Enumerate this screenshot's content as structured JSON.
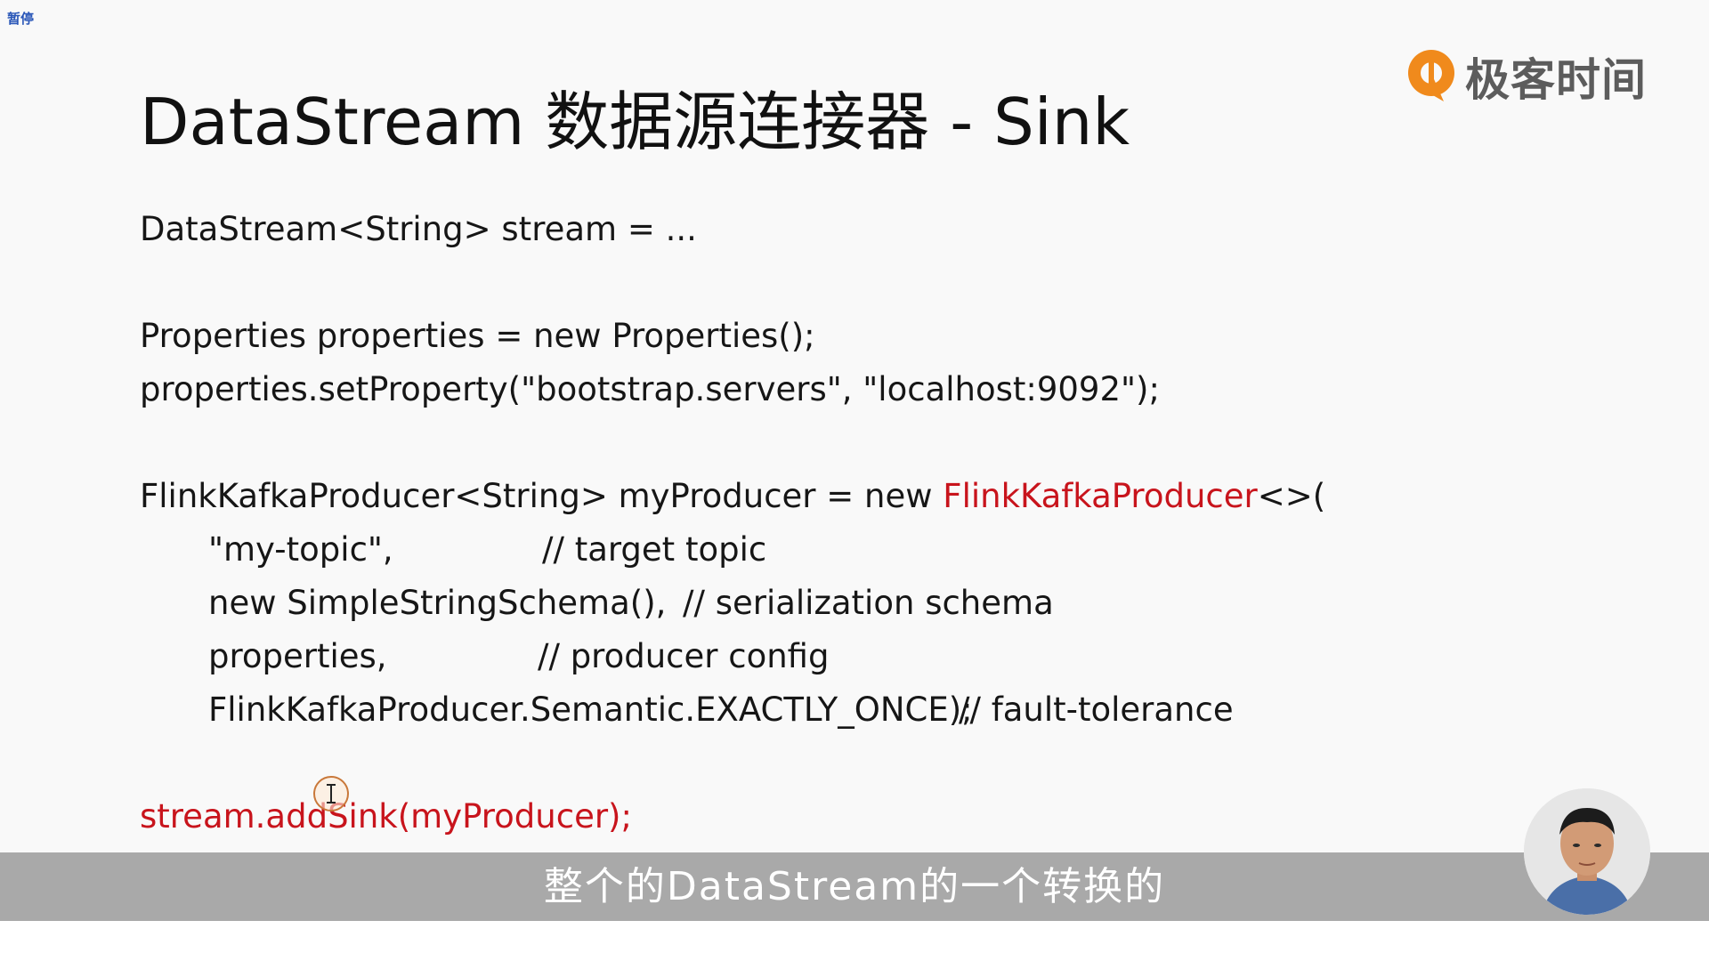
{
  "overlay": {
    "pause_label": "暂停"
  },
  "slide": {
    "title": "DataStream 数据源连接器 - Sink",
    "logo_text": "极客时间",
    "code": {
      "line1": "DataStream<String> stream = ...",
      "line2": "Properties properties = new Properties();",
      "line3": "properties.setProperty(\"bootstrap.servers\", \"localhost:9092\");",
      "line4_prefix": "FlinkKafkaProducer<String> myProducer = new ",
      "line4_class": "FlinkKafkaProducer",
      "line4_suffix": "<>(",
      "arg1": "\"my-topic\",",
      "arg1_comment": "// target topic",
      "arg2": "new SimpleStringSchema(),",
      "arg2_comment": "// serialization schema",
      "arg3": "properties,",
      "arg3_comment": "// producer config",
      "arg4": "FlinkKafkaProducer.Semantic.EXACTLY_ONCE);",
      "arg4_comment": "// fault-tolerance",
      "last_line": "stream.addSink(myProducer);"
    }
  },
  "subtitle": {
    "text": "整个的DataStream的一个转换的"
  },
  "colors": {
    "accent_red": "#c8141c",
    "logo_orange": "#f08a1c",
    "subtitle_bg": "#a9a9a9"
  },
  "icons": {
    "logo": "geektime-logo-icon",
    "cursor": "text-cursor-icon",
    "avatar": "presenter-avatar"
  }
}
